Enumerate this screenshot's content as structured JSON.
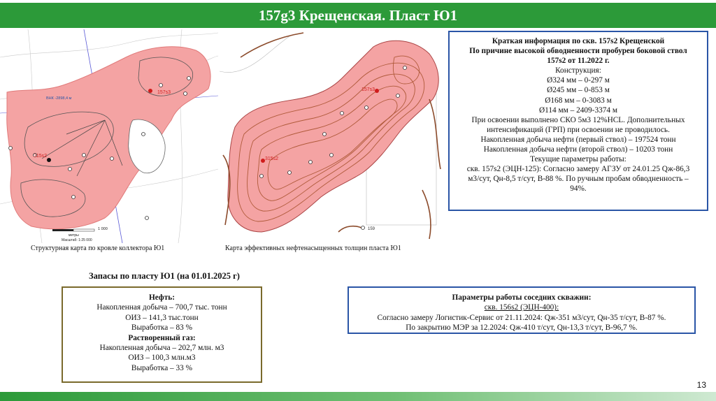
{
  "slide": {
    "title": "157g3 Крещенская. Пласт Ю1",
    "page_number": "13"
  },
  "maps": {
    "left_caption": "Структурная карта по кровле коллектора Ю1",
    "right_caption": "Карта эффективных нефтенасыщенных толщин пласта Ю1",
    "left_labels": {
      "well_157": "157s3",
      "well_315": "315s2",
      "vnk": "ВНК -2898,4 м",
      "scale_value": "1 000",
      "scale_units": "метры",
      "scale_ratio": "Масштаб: 1:25 000"
    },
    "right_labels": {
      "well_157": "157s3",
      "well_315": "315s2",
      "well_159": "159"
    }
  },
  "info": {
    "line1": "Краткая информация по скв. 157s2 Крещенской",
    "line2": "По причине высокой обводненности пробурен боковой ствол",
    "line3": "157s2 от 11.2022 г.",
    "line4": "Конструкция:",
    "line5": "Ø324 мм – 0-297 м",
    "line6": "Ø245 мм – 0-853 м",
    "line7": "Ø168 мм – 0-3083 м",
    "line8": "Ø114 мм – 2409-3374 м",
    "line9": "При освоении выполнено СКО 5м3 12%HCL. Дополнительных",
    "line10": "интенсификаций (ГРП) при освоении не проводилось.",
    "line11": "Накопленная добыча нефти (первый ствол) – 197524 тонн",
    "line12": "Накопленная добыча нефти (второй ствол) – 10203 тонн",
    "line13": "Текущие параметры работы:",
    "line14": "скв. 157s2 (ЭЦН-125): Согласно замеру АГЗУ от 24.01.25 Qж-86,3",
    "line15": "м3/сут, Qн-8,5 т/сут, В-88 %. По ручным пробам обводненность –",
    "line16": "94%."
  },
  "reserves": {
    "title": "Запасы по пласту Ю1 (на 01.01.2025 г)",
    "oil_header": "Нефть:",
    "oil_cum": "Накопленная добыча – 700,7 тыс. тонн",
    "oil_oiz": "ОИЗ – 141,3 тыс.тонн",
    "oil_dev": "Выработка – 83 %",
    "gas_header": "Растворенный газ:",
    "gas_cum": "Накопленная добыча – 202,7 млн. м3",
    "gas_oiz": "ОИЗ – 100,3 млн.м3",
    "gas_dev": "Выработка – 33 %"
  },
  "neighbors": {
    "header": "Параметры работы соседних скважин:",
    "well": "скв. 156s2 (ЭЦН-400):",
    "line1": "Согласно замеру Логистик-Сервис от 21.11.2024: Qж-351 м3/сут, Qн-35 т/сут, В-87 %.",
    "line2": "По закрытию МЭР за 12.2024: Qж-410 т/сут, Qн-13,3 т/сут, В-96,7 %."
  },
  "colors": {
    "header_green": "#2c9a39",
    "box_blue": "#2a55a6",
    "box_olive": "#7a6a2c",
    "map_fill": "#f4a3a3",
    "contour": "#b05a3a"
  }
}
